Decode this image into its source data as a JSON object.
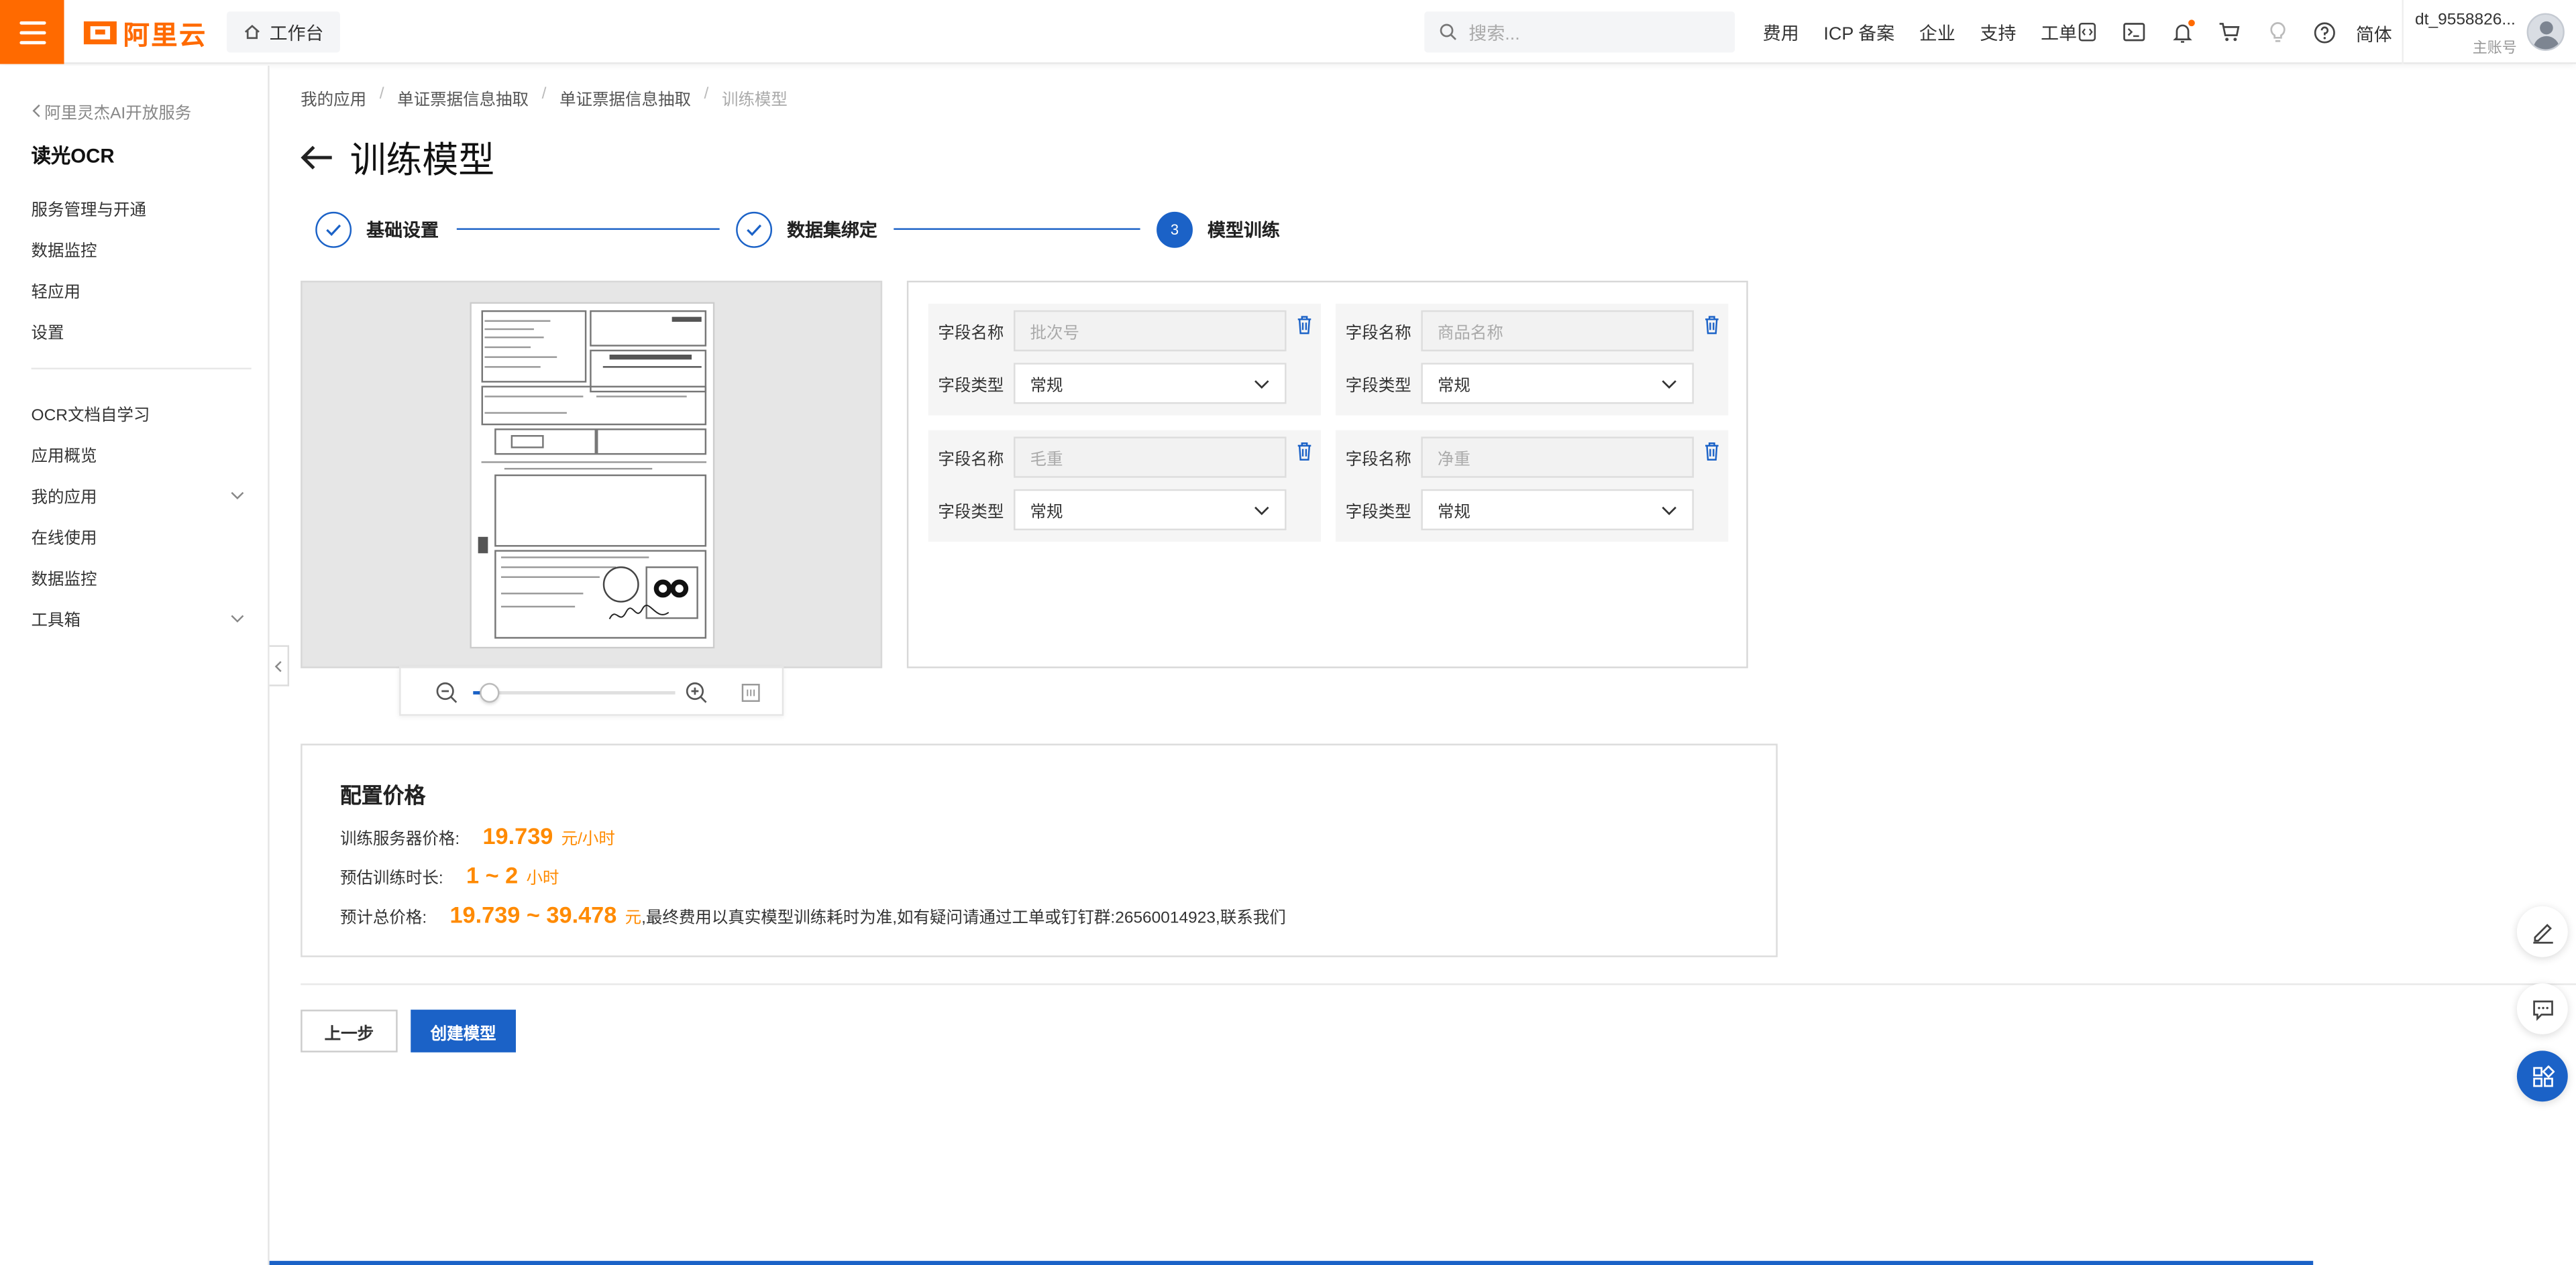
{
  "header": {
    "logo_text": "阿里云",
    "workbench_label": "工作台",
    "search_placeholder": "搜索...",
    "links": [
      "费用",
      "ICP 备案",
      "企业",
      "支持",
      "工单"
    ],
    "language": "简体",
    "user_name": "dt_9558826...",
    "user_role": "主账号",
    "accent_color": "#ff6a00"
  },
  "sidebar": {
    "back_label": "阿里灵杰AI开放服务",
    "title": "读光OCR",
    "group1": [
      "服务管理与开通",
      "数据监控",
      "轻应用",
      "设置"
    ],
    "group2": [
      "OCR文档自学习",
      "应用概览",
      "我的应用",
      "在线使用",
      "数据监控",
      "工具箱"
    ]
  },
  "breadcrumb": [
    "我的应用",
    "单证票据信息抽取",
    "单证票据信息抽取",
    "训练模型"
  ],
  "page": {
    "title": "训练模型"
  },
  "steps": [
    {
      "label": "基础设置",
      "status": "done"
    },
    {
      "label": "数据集绑定",
      "status": "done"
    },
    {
      "label": "模型训练",
      "status": "active",
      "number": "3"
    }
  ],
  "preview": {
    "zoom_level": 0.08
  },
  "fields": {
    "name_label": "字段名称",
    "type_label": "字段类型",
    "items": [
      {
        "name_placeholder": "批次号",
        "type": "常规"
      },
      {
        "name_placeholder": "商品名称",
        "type": "常规"
      },
      {
        "name_placeholder": "毛重",
        "type": "常规"
      },
      {
        "name_placeholder": "净重",
        "type": "常规"
      }
    ]
  },
  "pricing": {
    "heading": "配置价格",
    "server_label": "训练服务器价格:",
    "server_value": "19.739",
    "server_unit": "元/小时",
    "duration_label": "预估训练时长:",
    "duration_value": "1 ~ 2",
    "duration_unit": "小时",
    "total_label": "预计总价格:",
    "total_value": "19.739 ~ 39.478",
    "total_unit": "元",
    "total_note": ",最终费用以真实模型训练耗时为准,如有疑问请通过工单或钉钉群:26560014923,联系我们"
  },
  "actions": {
    "prev_label": "上一步",
    "create_label": "创建模型",
    "primary_color": "#1b62c7"
  }
}
